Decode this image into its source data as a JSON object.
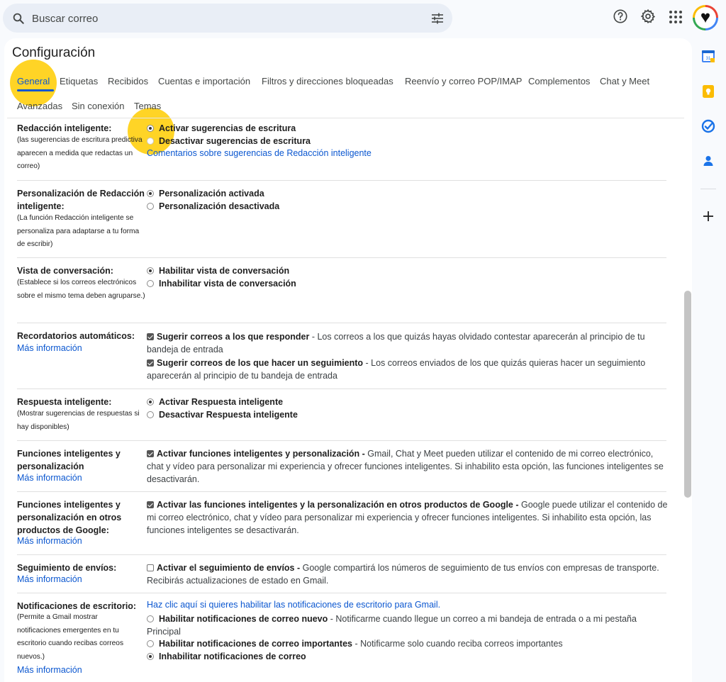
{
  "search": {
    "placeholder": "Buscar correo"
  },
  "header": {
    "avatar_glyph": "♥"
  },
  "page": {
    "title": "Configuración"
  },
  "tabs": [
    {
      "label": "General",
      "active": true
    },
    {
      "label": "Etiquetas"
    },
    {
      "label": "Recibidos"
    },
    {
      "label": "Cuentas e importación"
    },
    {
      "label": "Filtros y direcciones bloqueadas"
    },
    {
      "label": "Reenvío y correo POP/IMAP"
    },
    {
      "label": "Complementos"
    },
    {
      "label": "Chat y Meet"
    },
    {
      "label": "Avanzadas"
    },
    {
      "label": "Sin conexión"
    },
    {
      "label": "Temas"
    }
  ],
  "settings": {
    "smart_compose": {
      "label": "Redacción inteligente:",
      "desc": "(las sugerencias de escritura predictiva aparecen a medida que redactas un correo)",
      "opt_on": "Activar sugerencias de escritura",
      "opt_off": "Desactivar sugerencias de escritura",
      "feedback_link": "Comentarios sobre sugerencias de Redacción inteligente"
    },
    "personalization": {
      "label": "Personalización de Redacción inteligente:",
      "desc": "(La función Redacción inteligente se personaliza para adaptarse a tu forma de escribir)",
      "opt_on": "Personalización activada",
      "opt_off": "Personalización desactivada"
    },
    "conversation": {
      "label": "Vista de conversación:",
      "desc": "(Establece si los correos electrónicos sobre el mismo tema deben agruparse.)",
      "opt_on": "Habilitar vista de conversación",
      "opt_off": "Inhabilitar vista de conversación"
    },
    "nudges": {
      "label": "Recordatorios automáticos:",
      "more_info": "Más información",
      "opt1_bold": "Sugerir correos a los que responder",
      "opt1_rest": " - Los correos a los que quizás hayas olvidado contestar aparecerán al principio de tu bandeja de entrada",
      "opt2_bold": "Sugerir correos de los que hacer un seguimiento",
      "opt2_rest": " - Los correos enviados de los que quizás quieras hacer un seguimiento aparecerán al principio de tu bandeja de entrada"
    },
    "smart_reply": {
      "label": "Respuesta inteligente:",
      "desc": "(Mostrar sugerencias de respuestas si hay disponibles)",
      "opt_on": "Activar Respuesta inteligente",
      "opt_off": "Desactivar Respuesta inteligente"
    },
    "smart_features": {
      "label": "Funciones inteligentes y personalización",
      "more_info": "Más información",
      "bold": "Activar funciones inteligentes y personalización -",
      "rest": " Gmail, Chat y Meet pueden utilizar el contenido de mi correo electrónico, chat y vídeo para personalizar mi experiencia y ofrecer funciones inteligentes. Si inhabilito esta opción, las funciones inteligentes se desactivarán."
    },
    "other_products": {
      "label": "Funciones inteligentes y personalización en otros productos de Google:",
      "more_info": "Más información",
      "bold": "Activar las funciones inteligentes y la personalización en otros productos de Google -",
      "rest": " Google puede utilizar el contenido de mi correo electrónico, chat y vídeo para personalizar mi experiencia y ofrecer funciones inteligentes. Si inhabilito esta opción, las funciones inteligentes se desactivarán."
    },
    "package_tracking": {
      "label": "Seguimiento de envíos:",
      "more_info": "Más información",
      "bold": "Activar el seguimiento de envíos -",
      "rest": " Google compartirá los números de seguimiento de tus envíos con empresas de transporte. Recibirás actualizaciones de estado en Gmail."
    },
    "desktop_notifications": {
      "label": "Notificaciones de escritorio:",
      "desc": "(Permite a Gmail mostrar notificaciones emergentes en tu escritorio cuando recibas correos nuevos.)",
      "more_info": "Más información",
      "enable_link": "Haz clic aquí si quieres habilitar las notificaciones de escritorio para Gmail.",
      "opt1_bold": "Habilitar notificaciones de correo nuevo",
      "opt1_rest": " - Notificarme cuando llegue un correo a mi bandeja de entrada o a mi pestaña Principal",
      "opt2_bold": "Habilitar notificaciones de correo importantes",
      "opt2_rest": " - Notificarme solo cuando reciba correos importantes",
      "opt3_bold": "Inhabilitar notificaciones de correo"
    }
  },
  "colors": {
    "accent": "#0b57d0",
    "highlight": "#ffcc00"
  }
}
